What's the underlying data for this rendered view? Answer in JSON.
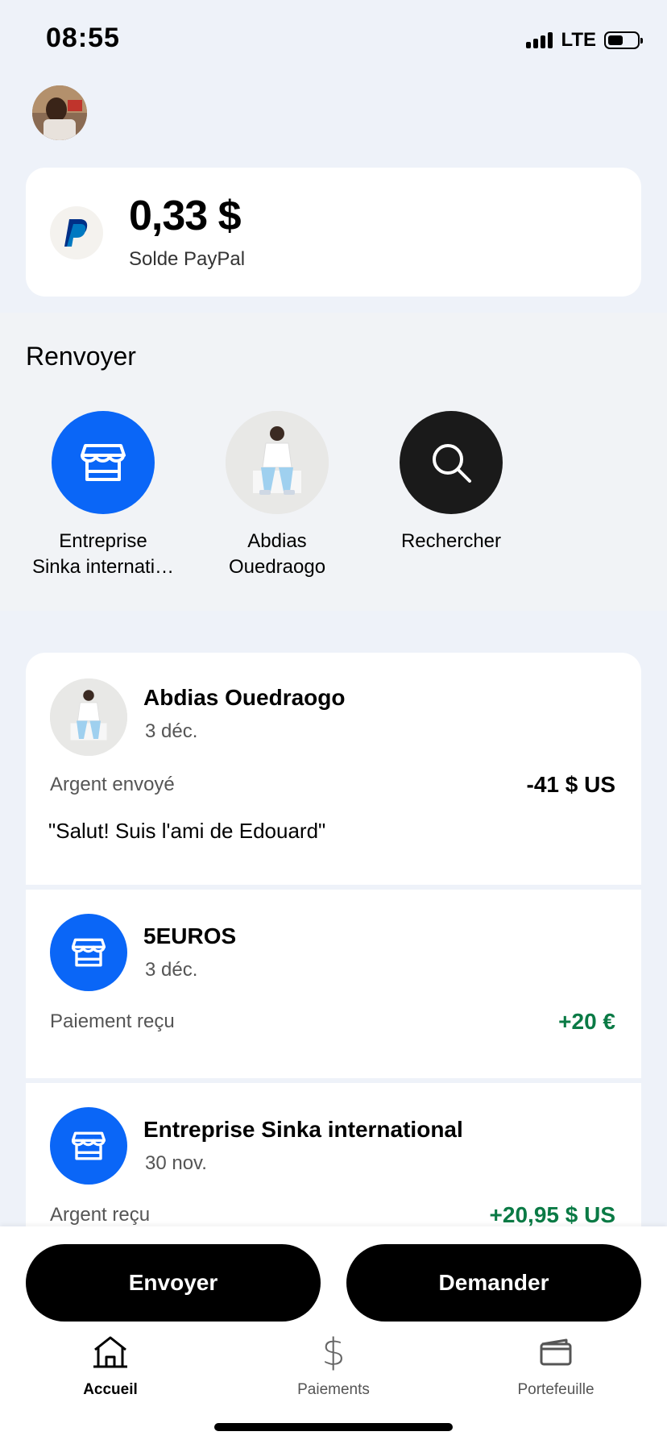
{
  "status_bar": {
    "time": "08:55",
    "network": "LTE"
  },
  "balance": {
    "amount": "0,33 $",
    "label": "Solde PayPal"
  },
  "resend": {
    "title": "Renvoyer",
    "items": [
      {
        "label_line1": "Entreprise",
        "label_line2": "Sinka internati…",
        "icon": "store-icon"
      },
      {
        "label_line1": "Abdias",
        "label_line2": "Ouedraogo",
        "icon": "contact-photo"
      },
      {
        "label_line1": "Rechercher",
        "label_line2": "",
        "icon": "search-icon"
      }
    ]
  },
  "transactions": [
    {
      "name": "Abdias Ouedraogo",
      "date": "3 déc.",
      "type": "Argent envoyé",
      "amount": "-41 $ US",
      "note": "\"Salut! Suis l'ami de Edouard\""
    },
    {
      "name": "5EUROS",
      "date": "3 déc.",
      "type": "Paiement reçu",
      "amount": "+20 €"
    },
    {
      "name": "Entreprise Sinka international",
      "date": "30 nov.",
      "type": "Argent reçu",
      "amount": "+20,95 $ US"
    }
  ],
  "actions": {
    "send": "Envoyer",
    "request": "Demander"
  },
  "nav": [
    {
      "label": "Accueil",
      "icon": "home-icon",
      "active": true
    },
    {
      "label": "Paiements",
      "icon": "dollar-icon",
      "active": false
    },
    {
      "label": "Portefeuille",
      "icon": "wallet-icon",
      "active": false
    }
  ],
  "colors": {
    "accent_blue": "#0a66f7",
    "positive_green": "#0a7a45",
    "page_bg": "#eef2f9"
  }
}
